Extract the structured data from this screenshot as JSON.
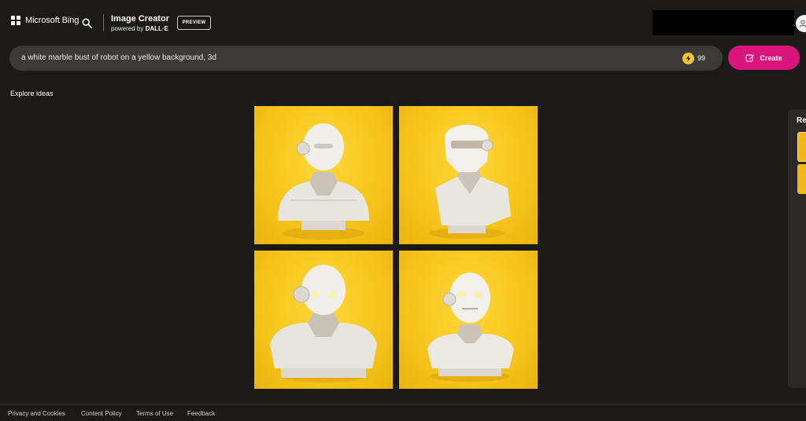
{
  "header": {
    "brand_name": "Microsoft Bing",
    "app_title": "Image Creator",
    "powered_prefix": "powered by",
    "powered_by": "DALL·E",
    "preview_badge": "PREVIEW"
  },
  "prompt": {
    "text": "a white marble bust of robot on a yellow background, 3d",
    "boost_count": "99",
    "create_label": "Create"
  },
  "explore_label": "Explore ideas",
  "results": [
    {
      "kind": "robot-bust"
    },
    {
      "kind": "robot-bust"
    },
    {
      "kind": "robot-bust"
    },
    {
      "kind": "robot-bust"
    }
  ],
  "side_panel": {
    "title_fragment": "Re"
  },
  "footer": {
    "links": [
      "Privacy and Cookies",
      "Content Policy",
      "Terms of Use",
      "Feedback"
    ]
  },
  "colors": {
    "background": "#1b1a19",
    "prompt_bar": "#3b3a39",
    "create_button": "#d9157c",
    "image_background": "#f6c41b",
    "boost_icon": "#f8c42c"
  },
  "icons": [
    "windows-logo-icon",
    "search-icon",
    "boost-icon",
    "create-pencil-icon",
    "profile-icon"
  ]
}
